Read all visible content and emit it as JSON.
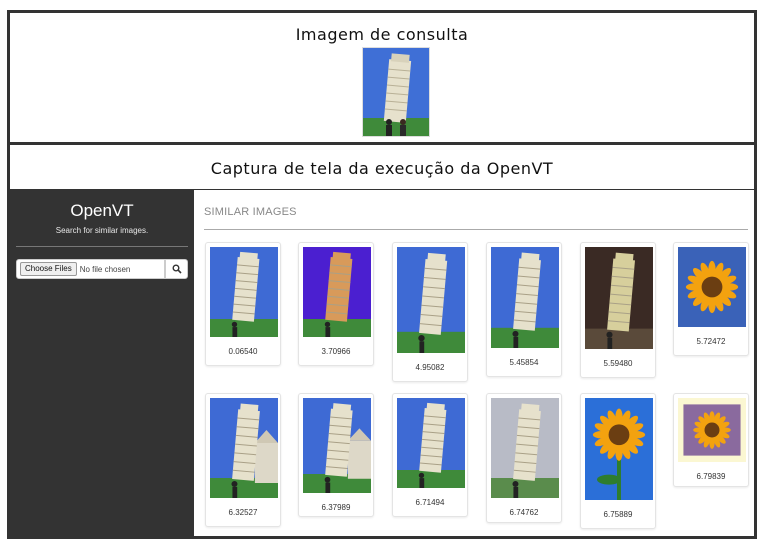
{
  "query_panel": {
    "title": "Imagem de consulta"
  },
  "caption_panel": {
    "title": "Captura de tela da execução da OpenVT"
  },
  "sidebar": {
    "brand": "OpenVT",
    "tagline": "Search for similar images.",
    "file_button_label": "Choose Files",
    "file_status": "No file chosen",
    "search_icon": "search-icon"
  },
  "main": {
    "heading": "SIMILAR IMAGES",
    "results": [
      {
        "score": "0.06540",
        "subject": "tower"
      },
      {
        "score": "3.70966",
        "subject": "tower-purple"
      },
      {
        "score": "4.95082",
        "subject": "tower"
      },
      {
        "score": "5.45854",
        "subject": "tower"
      },
      {
        "score": "5.59480",
        "subject": "tower-night"
      },
      {
        "score": "5.72472",
        "subject": "sunflower"
      },
      {
        "score": "6.32527",
        "subject": "tower-cathedral"
      },
      {
        "score": "6.37989",
        "subject": "tower-cathedral"
      },
      {
        "score": "6.71494",
        "subject": "tower"
      },
      {
        "score": "6.74762",
        "subject": "tower-gray"
      },
      {
        "score": "6.75889",
        "subject": "sunflower-sky"
      },
      {
        "score": "6.79839",
        "subject": "sunflower-framed"
      }
    ]
  },
  "colors": {
    "frame": "#333333",
    "sidebar_bg": "#333333",
    "sky": "#3b64c8",
    "tower": "#e2ddc8",
    "grass": "#3f8a3a",
    "sunflower": "#f3a20f"
  }
}
